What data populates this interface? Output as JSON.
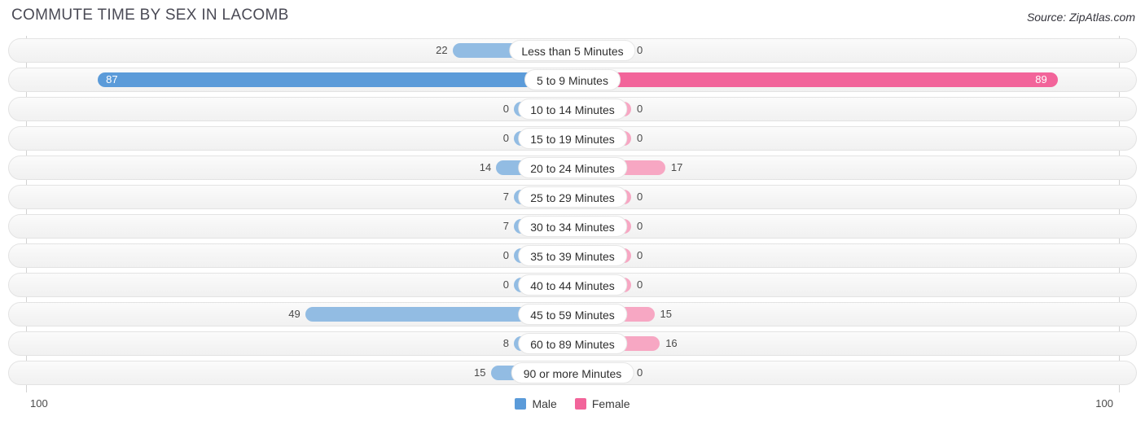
{
  "header": {
    "title": "COMMUTE TIME BY SEX IN LACOMB",
    "source": "Source: ZipAtlas.com"
  },
  "legend": {
    "male_label": "Male",
    "female_label": "Female",
    "male_color": "#5b9bd9",
    "female_color": "#f2649a"
  },
  "axis": {
    "left_tick": "100",
    "right_tick": "100",
    "max": 100
  },
  "colors": {
    "male": "#92bce3",
    "female": "#f7a7c3",
    "male_highlight": "#5b9bd9",
    "female_highlight": "#f2649a",
    "track": "#f4f4f4",
    "track_border": "#e3e3e3"
  },
  "chart_data": {
    "type": "bar",
    "title": "COMMUTE TIME BY SEX IN LACOMB",
    "subtitle": "Source: ZipAtlas.com",
    "orientation": "horizontal",
    "style": "diverging-bidirectional",
    "xlabel": "",
    "ylabel": "",
    "xlim": [
      100,
      100
    ],
    "grid": false,
    "legend_position": "bottom-center",
    "categories": [
      "Less than 5 Minutes",
      "5 to 9 Minutes",
      "10 to 14 Minutes",
      "15 to 19 Minutes",
      "20 to 24 Minutes",
      "25 to 29 Minutes",
      "30 to 34 Minutes",
      "35 to 39 Minutes",
      "40 to 44 Minutes",
      "45 to 59 Minutes",
      "60 to 89 Minutes",
      "90 or more Minutes"
    ],
    "series": [
      {
        "name": "Male",
        "values": [
          22,
          87,
          0,
          0,
          14,
          7,
          7,
          0,
          0,
          49,
          8,
          15
        ]
      },
      {
        "name": "Female",
        "values": [
          0,
          89,
          0,
          0,
          17,
          0,
          0,
          0,
          0,
          15,
          16,
          0
        ]
      }
    ]
  },
  "rows": [
    {
      "label": "Less than 5 Minutes",
      "male": "22",
      "female": "0",
      "male_value": 22,
      "female_value": 0,
      "highlight": false
    },
    {
      "label": "5 to 9 Minutes",
      "male": "87",
      "female": "89",
      "male_value": 87,
      "female_value": 89,
      "highlight": true
    },
    {
      "label": "10 to 14 Minutes",
      "male": "0",
      "female": "0",
      "male_value": 0,
      "female_value": 0,
      "highlight": false
    },
    {
      "label": "15 to 19 Minutes",
      "male": "0",
      "female": "0",
      "male_value": 0,
      "female_value": 0,
      "highlight": false
    },
    {
      "label": "20 to 24 Minutes",
      "male": "14",
      "female": "17",
      "male_value": 14,
      "female_value": 17,
      "highlight": false
    },
    {
      "label": "25 to 29 Minutes",
      "male": "7",
      "female": "0",
      "male_value": 7,
      "female_value": 0,
      "highlight": false
    },
    {
      "label": "30 to 34 Minutes",
      "male": "7",
      "female": "0",
      "male_value": 7,
      "female_value": 0,
      "highlight": false
    },
    {
      "label": "35 to 39 Minutes",
      "male": "0",
      "female": "0",
      "male_value": 0,
      "female_value": 0,
      "highlight": false
    },
    {
      "label": "40 to 44 Minutes",
      "male": "0",
      "female": "0",
      "male_value": 0,
      "female_value": 0,
      "highlight": false
    },
    {
      "label": "45 to 59 Minutes",
      "male": "49",
      "female": "15",
      "male_value": 49,
      "female_value": 15,
      "highlight": false
    },
    {
      "label": "60 to 89 Minutes",
      "male": "8",
      "female": "16",
      "male_value": 8,
      "female_value": 16,
      "highlight": false
    },
    {
      "label": "90 or more Minutes",
      "male": "15",
      "female": "0",
      "male_value": 15,
      "female_value": 0,
      "highlight": false
    }
  ]
}
